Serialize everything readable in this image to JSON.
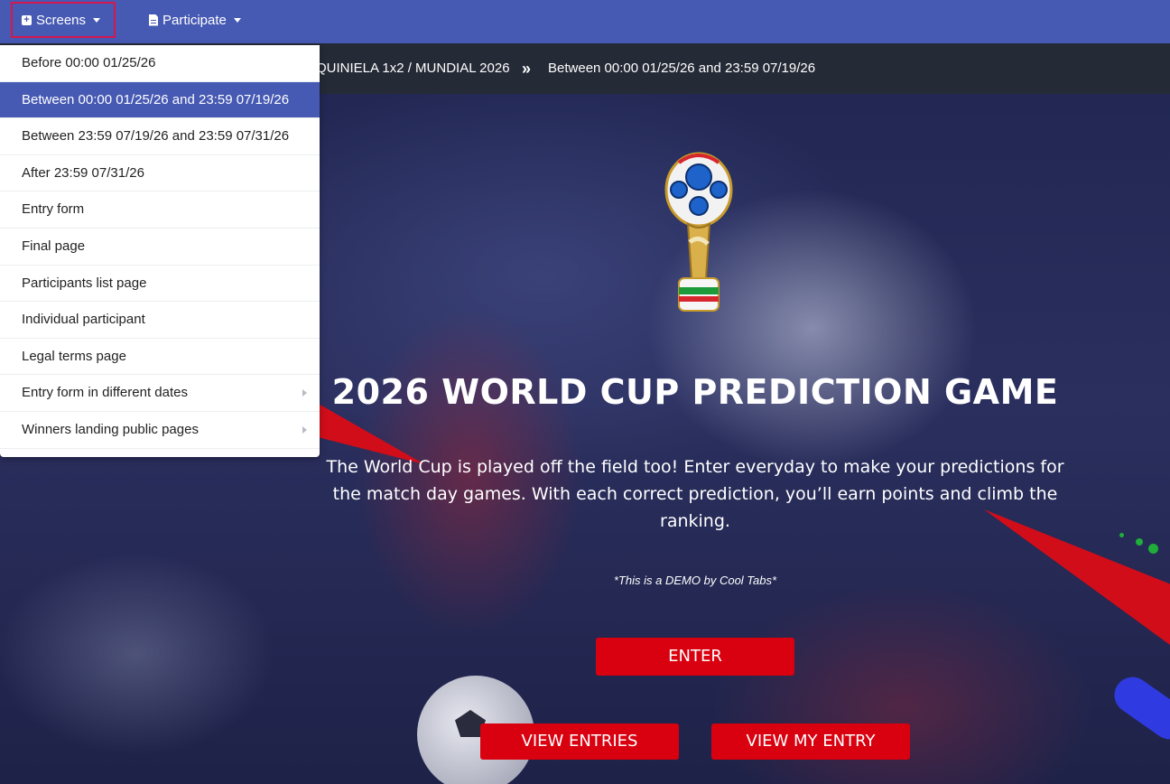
{
  "nav": {
    "screens_label": "Screens",
    "participate_label": "Participate"
  },
  "breadcrumb": {
    "section": "QUINIELA 1x2 / MUNDIAL 2026",
    "separator": "»",
    "current": "Between 00:00 01/25/26 and 23:59 07/19/26"
  },
  "dropdown": {
    "items": [
      {
        "label": "Before 00:00 01/25/26"
      },
      {
        "label": "Between 00:00 01/25/26 and 23:59 07/19/26",
        "active": true
      },
      {
        "label": "Between 23:59 07/19/26 and 23:59 07/31/26"
      },
      {
        "label": "After 23:59 07/31/26"
      },
      {
        "label": "Entry form"
      },
      {
        "label": "Final page"
      },
      {
        "label": "Participants list page"
      },
      {
        "label": "Individual participant"
      },
      {
        "label": "Legal terms page"
      },
      {
        "label": "Entry form in different dates",
        "submenu": true
      },
      {
        "label": "Winners landing public pages",
        "submenu": true
      }
    ]
  },
  "hero": {
    "title": "2026 WORLD CUP PREDICTION GAME",
    "subtitle": "The World Cup is played off the field too! Enter everyday to make your predictions for the match day games. With each correct prediction, you’ll earn points and climb the ranking.",
    "demo_note": "*This is a DEMO by Cool Tabs*",
    "enter_label": "ENTER",
    "view_entries_label": "VIEW ENTRIES",
    "view_my_entry_label": "VIEW MY ENTRY"
  },
  "colors": {
    "topbar": "#4659b3",
    "breadcrumb_bar": "#242a36",
    "accent_red": "#d9000f",
    "highlight_border": "#d6164e"
  }
}
